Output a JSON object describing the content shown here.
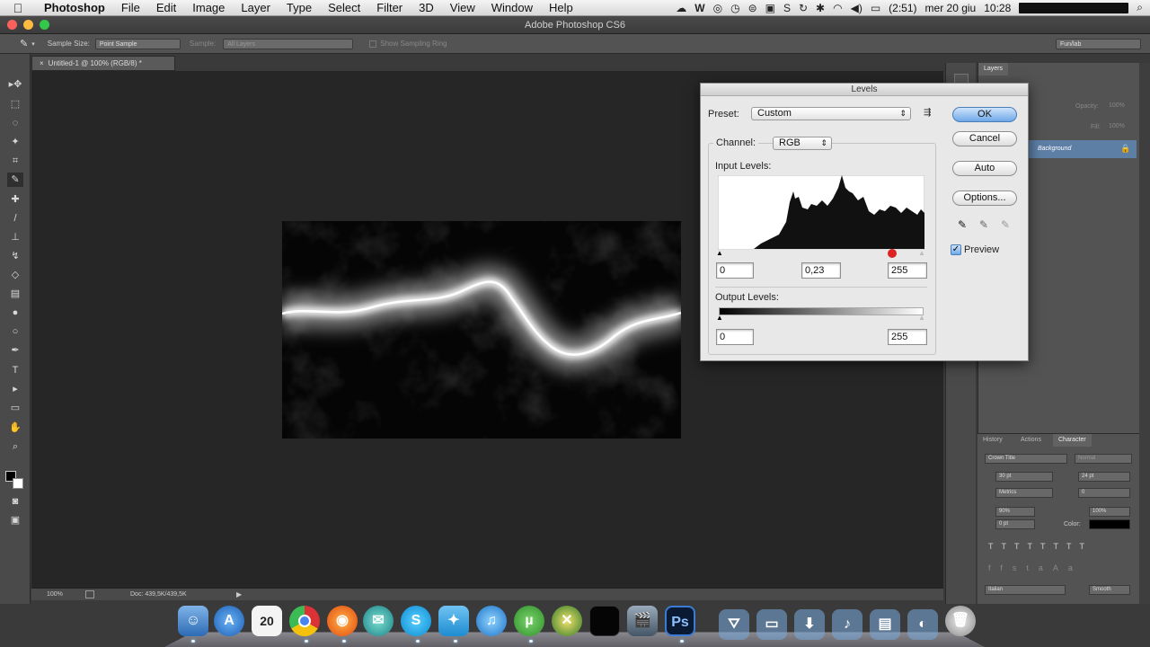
{
  "menubar": {
    "app": "Photoshop",
    "items": [
      "File",
      "Edit",
      "Image",
      "Layer",
      "Type",
      "Select",
      "Filter",
      "3D",
      "View",
      "Window",
      "Help"
    ],
    "battery": "(2:51)",
    "date": "mer 20 giu",
    "time": "10:28"
  },
  "window": {
    "title": "Adobe Photoshop CS6"
  },
  "options": {
    "sample_size_label": "Sample Size:",
    "sample_size_value": "Point Sample",
    "sample_label": "Sample:",
    "sample_value": "All Layers",
    "show_ring_label": "Show Sampling Ring",
    "workspace": "Fun/lab"
  },
  "document": {
    "tab_title": "Untitled-1 @ 100% (RGB/8) *",
    "zoom": "100%",
    "doc_size": "Doc: 439,5K/439,5K"
  },
  "layers_panel": {
    "tab": "Layers",
    "opacity_label": "Opacity:",
    "opacity_value": "100%",
    "fill_label": "Fill:",
    "fill_value": "100%",
    "layer_name": "Background"
  },
  "character_panel": {
    "tabs": [
      "History",
      "Actions",
      "Character"
    ],
    "font_family": "Crown Title",
    "font_style": "Normal",
    "font_size": "30 pt",
    "leading": "24 pt",
    "kerning": "Metrics",
    "tracking": "0",
    "vertical_scale": "90%",
    "horizontal_scale": "100%",
    "baseline": "0 pt",
    "color_label": "Color:",
    "language": "Italian",
    "antialias": "Smooth"
  },
  "levels": {
    "title": "Levels",
    "preset_label": "Preset:",
    "preset_value": "Custom",
    "channel_label": "Channel:",
    "channel_value": "RGB",
    "input_levels_label": "Input Levels:",
    "input_black": "0",
    "input_gamma": "0,23",
    "input_white": "255",
    "output_levels_label": "Output Levels:",
    "output_black": "0",
    "output_white": "255",
    "buttons": {
      "ok": "OK",
      "cancel": "Cancel",
      "auto": "Auto",
      "options": "Options..."
    },
    "preview_label": "Preview",
    "preview_checked": true
  },
  "dock": {
    "calendar_day": "20",
    "photoshop_label": "Ps"
  }
}
